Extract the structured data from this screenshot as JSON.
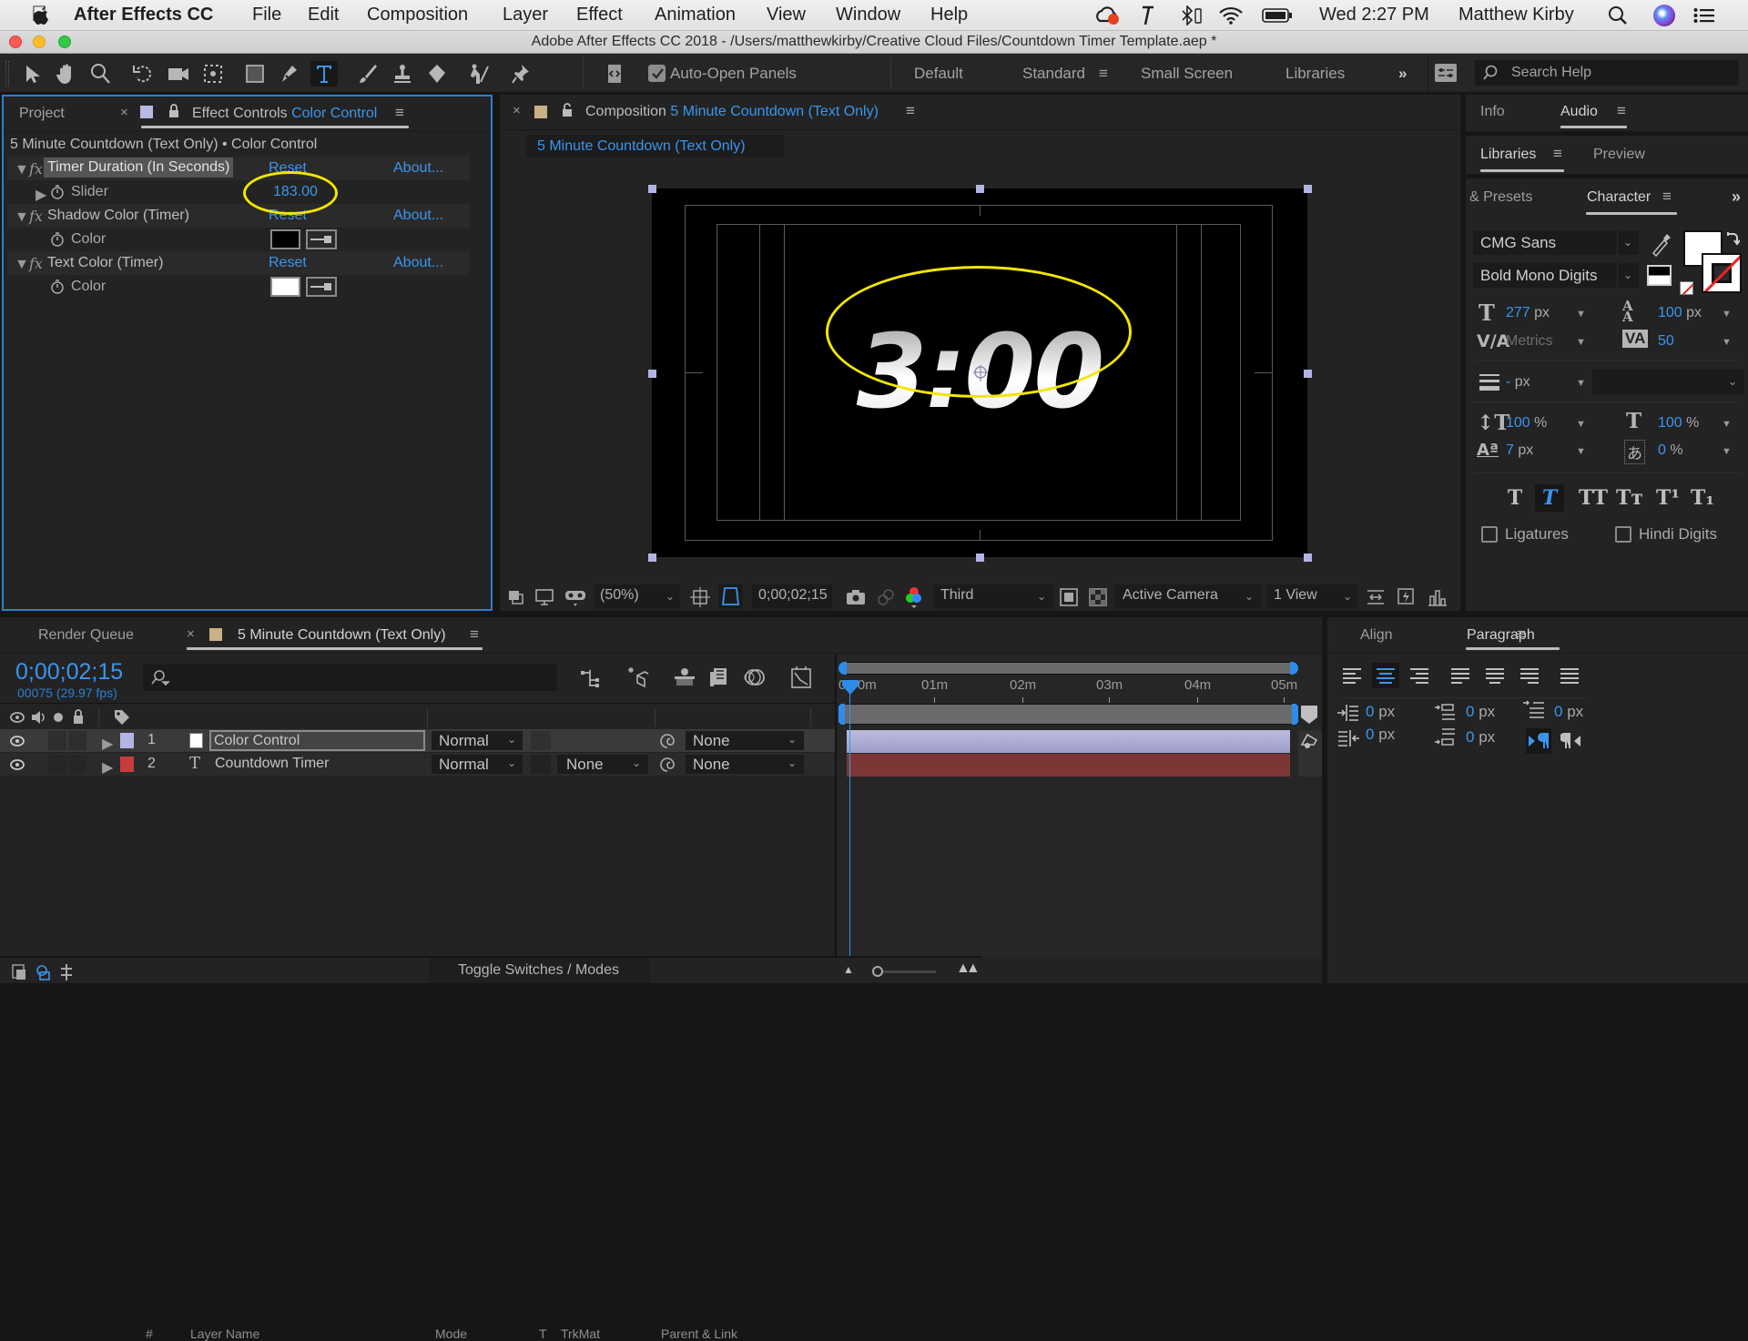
{
  "menubar": {
    "app_name": "After Effects CC",
    "menus": [
      "File",
      "Edit",
      "Composition",
      "Layer",
      "Effect",
      "Animation",
      "View",
      "Window",
      "Help"
    ],
    "clock": "Wed 2:27 PM",
    "user": "Matthew Kirby",
    "status_icons": [
      "creative-cloud-icon",
      "hammer-icon",
      "bluetooth-icon",
      "wifi-icon",
      "battery-icon",
      "spotlight-search-icon",
      "siri-icon",
      "notification-center-icon"
    ]
  },
  "window": {
    "title": "Adobe After Effects CC 2018 - /Users/matthewkirby/Creative Cloud Files/Countdown Timer Template.aep *"
  },
  "toolbar": {
    "tools": [
      "selection",
      "hand",
      "zoom",
      "rotation",
      "unified-camera",
      "pan-behind",
      "rectangle",
      "pen",
      "type",
      "brush",
      "clone-stamp",
      "eraser",
      "roto-brush",
      "puppet-pin"
    ],
    "active_tool": "type",
    "auto_open_label": "Auto-Open Panels",
    "auto_open_checked": true,
    "workspaces": [
      "Default",
      "Standard",
      "Small Screen",
      "Libraries"
    ],
    "active_workspace": "Standard",
    "overflow": "»",
    "search_placeholder": "Search Help"
  },
  "left_panel": {
    "project_tab": "Project",
    "effect_controls_tab": "Effect Controls",
    "effect_controls_target": "Color Control",
    "subtitle": "5 Minute Countdown (Text Only) • Color Control",
    "effects": [
      {
        "name": "Timer Duration (In Seconds)",
        "reset": "Reset",
        "about": "About...",
        "property": "Slider",
        "value": "183.00"
      },
      {
        "name": "Shadow Color (Timer)",
        "reset": "Reset",
        "about": "About...",
        "property": "Color",
        "color": "#000000"
      },
      {
        "name": "Text Color (Timer)",
        "reset": "Reset",
        "about": "About...",
        "property": "Color",
        "color": "#ffffff"
      }
    ]
  },
  "composition": {
    "panel_label": "Composition",
    "name": "5 Minute Countdown (Text Only)",
    "viewer_tab": "5 Minute Countdown (Text Only)",
    "canvas_text": "3:00",
    "viewer_bar": {
      "magnification": "(50%)",
      "timecode": "0;00;02;15",
      "resolution": "Third",
      "camera": "Active Camera",
      "views": "1 View"
    }
  },
  "right_panel": {
    "tabs_row1": [
      "Info",
      "Audio"
    ],
    "tabs_row2": [
      "Libraries",
      "Preview"
    ],
    "tabs_row3": [
      "& Presets",
      "Character"
    ],
    "overflow": "»",
    "character": {
      "font_family": "CMG Sans",
      "font_style": "Bold Mono Digits",
      "font_size": "277",
      "font_size_unit": "px",
      "leading": "100",
      "leading_unit": "px",
      "kerning": "Metrics",
      "tracking": "50",
      "stroke_width": "-",
      "stroke_unit": "px",
      "vertical_scale": "100",
      "vertical_scale_unit": "%",
      "horizontal_scale": "100",
      "horizontal_scale_unit": "%",
      "baseline_shift": "7",
      "baseline_shift_unit": "px",
      "tsume": "0",
      "tsume_unit": "%",
      "styles": [
        "T",
        "T",
        "TT",
        "Tт",
        "T¹",
        "T₁"
      ],
      "active_style": "faux-italic",
      "ligatures_label": "Ligatures",
      "ligatures_checked": false,
      "hindi_digits_label": "Hindi Digits",
      "hindi_digits_checked": false
    }
  },
  "timeline": {
    "render_queue_tab": "Render Queue",
    "comp_tab": "5 Minute Countdown (Text Only)",
    "current_time": "0;00;02;15",
    "frame_info": "00075 (29.97 fps)",
    "search_placeholder": "",
    "columns": {
      "number": "#",
      "layer_name": "Layer Name",
      "mode": "Mode",
      "t": "T",
      "trkmat": "TrkMat",
      "parent": "Parent & Link"
    },
    "layers": [
      {
        "index": "1",
        "name": "Color Control",
        "type": "solid",
        "mode": "Normal",
        "trkmat": "",
        "parent": "None",
        "label_color": "#b4b4e4"
      },
      {
        "index": "2",
        "name": "Countdown Timer",
        "type": "text",
        "mode": "Normal",
        "trkmat": "None",
        "parent": "None",
        "label_color": "#c83c3c"
      }
    ],
    "ruler": [
      "0:00m",
      "01m",
      "02m",
      "03m",
      "04m",
      "05m"
    ],
    "playhead_fraction": 0.0083,
    "toggle_label": "Toggle Switches / Modes"
  },
  "paragraph": {
    "align_tab": "Align",
    "paragraph_tab": "Paragraph",
    "active_alignment": "center",
    "indent_left": "0",
    "indent_right": "0",
    "indent_first": "0",
    "space_before": "0",
    "space_after": "0",
    "unit": "px"
  },
  "colors": {
    "accent": "#3b95ee",
    "annotation": "#f2e600",
    "comp_swatch": "#c9b185",
    "layer_bar_1": "#a6a6cf",
    "layer_bar_2": "#7d3636"
  }
}
